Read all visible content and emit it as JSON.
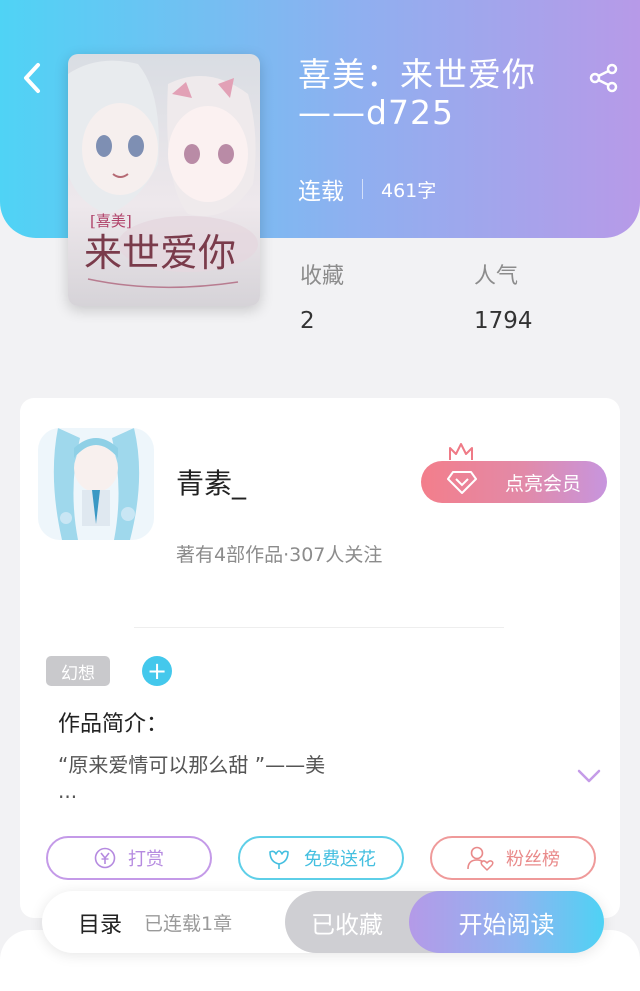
{
  "book": {
    "title": "喜美：来世爱你——d725",
    "status": "连载",
    "word_count": "461字",
    "cover_title_main": "来世爱你",
    "cover_title_tag": "喜美"
  },
  "stats": {
    "favorites_label": "收藏",
    "favorites_value": "2",
    "popularity_label": "人气",
    "popularity_value": "1794"
  },
  "author": {
    "name": "青素_",
    "meta": "著有4部作品·307人关注",
    "vip_button": "点亮会员"
  },
  "tags": [
    "幻想"
  ],
  "intro": {
    "heading": "作品简介：",
    "text": "“原来爱情可以那么甜 ”——美",
    "ellipsis": "..."
  },
  "actions": {
    "reward": "打赏",
    "flower": "免费送花",
    "fans": "粉丝榜"
  },
  "bottom_bar": {
    "toc": "目录",
    "chapter_count": "已连载1章",
    "collected": "已收藏",
    "read": "开始阅读"
  },
  "colors": {
    "header_gradient_start": "#4fd3f5",
    "header_gradient_end": "#b79ae8",
    "accent_cyan": "#44c8ec",
    "accent_purple": "#b58ae0",
    "accent_pink": "#e98a8a"
  },
  "icons": {
    "back": "chevron-left-icon",
    "share": "share-icon",
    "vip": "diamond-icon",
    "crown": "crown-icon",
    "add_tag": "plus-icon",
    "expand": "chevron-down-icon",
    "reward": "yen-coin-icon",
    "flower": "flower-icon",
    "fans": "user-heart-icon"
  }
}
